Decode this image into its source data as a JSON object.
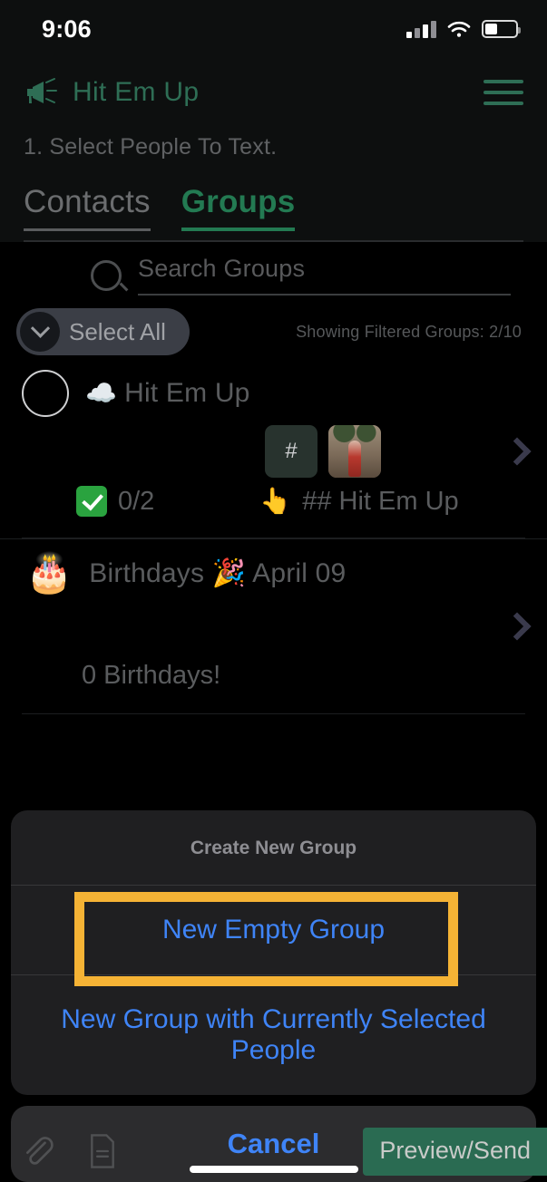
{
  "status_bar": {
    "time": "9:06",
    "signal_icon": "cellular-signal-icon",
    "wifi_icon": "wifi-icon",
    "battery_icon": "battery-icon",
    "battery_level_pct": 42
  },
  "header": {
    "brand_icon": "megaphone-icon",
    "brand_title": "Hit Em Up",
    "menu_icon": "hamburger-menu-icon",
    "step_label": "1. Select People To Text.",
    "accent_color": "#2e6e55",
    "tabs": [
      {
        "label": "Contacts",
        "active": false
      },
      {
        "label": "Groups",
        "active": true
      }
    ]
  },
  "search": {
    "icon": "search-icon",
    "placeholder": "Search Groups",
    "value": ""
  },
  "toolbar": {
    "select_all_label": "Select All",
    "select_all_icon": "chevron-down-icon",
    "filter_count": "Showing Filtered Groups: 2/10"
  },
  "groups": [
    {
      "icon": "cloud-emoji",
      "emoji": "☁️",
      "title": "Hit Em Up",
      "selected": false,
      "thumbs": [
        {
          "type": "hash-thumbnail",
          "label": "#"
        },
        {
          "type": "photo-thumbnail",
          "label": ""
        }
      ],
      "count_badge_icon": "green-check-icon",
      "count": "0/2",
      "hint_icon": "pointing-finger-emoji",
      "hint_emoji": "👆",
      "hint_text": "## Hit Em Up",
      "chevron_icon": "chevron-right-icon"
    },
    {
      "icon": "birthday-cake-emoji",
      "emoji": "🎂",
      "title_prefix": "Birthdays ",
      "title_emoji": "🎉",
      "title_suffix": " April 09",
      "title": "Birthdays 🎉 April 09",
      "subtitle": "0 Birthdays!",
      "chevron_icon": "chevron-right-icon"
    }
  ],
  "action_sheet": {
    "title": "Create New Group",
    "actions": [
      {
        "label": "New Empty Group",
        "highlighted": true
      },
      {
        "label": "New Group with Currently Selected People",
        "highlighted": false
      }
    ],
    "cancel_label": "Cancel",
    "highlight_color": "#f5b335",
    "action_color": "#3f84f7"
  },
  "bottom_bar": {
    "attachment_icon": "paperclip-icon",
    "template_icon": "document-icon",
    "preview_send_label": "Preview/Send",
    "preview_send_color": "#2a6b52"
  }
}
